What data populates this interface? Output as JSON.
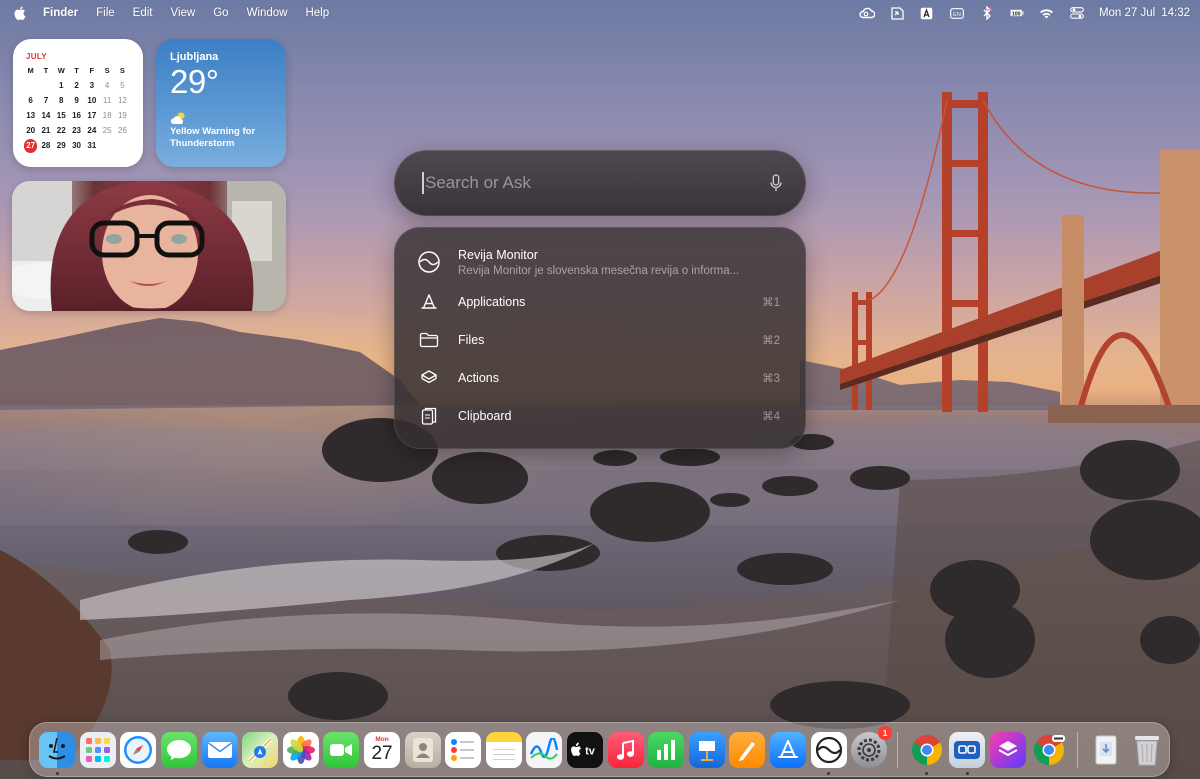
{
  "menubar": {
    "app_name": "Finder",
    "menus": [
      "File",
      "Edit",
      "View",
      "Go",
      "Window",
      "Help"
    ],
    "status_icons": [
      "creative-cloud-icon",
      "screen-share-icon",
      "a-box-icon",
      "keyboard-input-icon",
      "bluetooth-mixed-icon",
      "battery-icon",
      "wifi-icon",
      "control-center-icon"
    ],
    "date": "Mon 27 Jul",
    "time": "14:32"
  },
  "calendar_widget": {
    "month": "JULY",
    "weekdays": [
      "M",
      "T",
      "W",
      "T",
      "F",
      "S",
      "S"
    ],
    "weeks": [
      [
        "",
        "1",
        "2",
        "3",
        "4",
        "5"
      ],
      [
        "6",
        "7",
        "8",
        "9",
        "10",
        "11",
        "12"
      ],
      [
        "13",
        "14",
        "15",
        "16",
        "17",
        "18",
        "19"
      ],
      [
        "20",
        "21",
        "22",
        "23",
        "24",
        "25",
        "26"
      ],
      [
        "27",
        "28",
        "29",
        "30",
        "31",
        "",
        ""
      ]
    ],
    "today": "27"
  },
  "weather_widget": {
    "city": "Ljubljana",
    "temperature": "29°",
    "condition_icon": "partly-cloudy-icon",
    "warning": "Yellow Warning for Thunderstorm"
  },
  "spotlight": {
    "placeholder": "Search or Ask",
    "top_result": {
      "title": "Revija Monitor",
      "subtitle": "Revija Monitor je slovenska mesečna revija o informa..."
    },
    "categories": [
      {
        "label": "Applications",
        "shortcut": "⌘1",
        "icon": "applications-icon"
      },
      {
        "label": "Files",
        "shortcut": "⌘2",
        "icon": "folder-icon"
      },
      {
        "label": "Actions",
        "shortcut": "⌘3",
        "icon": "actions-icon"
      },
      {
        "label": "Clipboard",
        "shortcut": "⌘4",
        "icon": "clipboard-icon"
      }
    ]
  },
  "dock": {
    "calendar_month": "Mon",
    "calendar_day": "27",
    "settings_badge": "1",
    "apps": [
      "Finder",
      "Launchpad",
      "Safari",
      "Messages",
      "Mail",
      "Maps",
      "Photos",
      "FaceTime",
      "Calendar",
      "Contacts",
      "Reminders",
      "Notes",
      "Freeform",
      "TV",
      "Music",
      "Numbers",
      "Keynote",
      "Pages",
      "App Store",
      "Monitor",
      "System Settings",
      "Chrome",
      "Screen Sharing",
      "Shortcuts",
      "Chrome Canary",
      "Downloads",
      "Trash"
    ],
    "colors": {
      "accent": "#0a84ff",
      "badge": "#ff3b30"
    }
  }
}
